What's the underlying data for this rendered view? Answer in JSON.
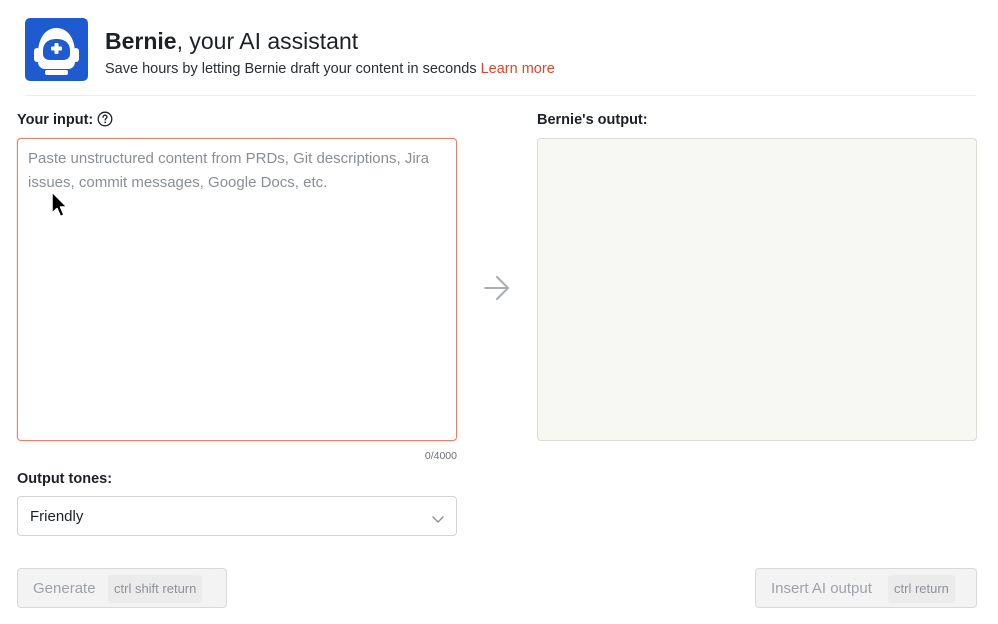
{
  "header": {
    "brand_name": "Bernie",
    "title_rest": ", your AI assistant",
    "subtitle": "Save hours by letting Bernie draft your content in seconds",
    "learn_more": "Learn more",
    "logo_icon": "astronaut-helmet-icon",
    "brand_color": "#1f5bd0",
    "link_color": "#e0452a"
  },
  "input": {
    "label": "Your input:",
    "help_icon": "question-circle-icon",
    "placeholder": "Paste unstructured content from PRDs, Git descriptions, Jira issues, commit messages, Google Docs, etc.",
    "value": "",
    "counter": "0/4000",
    "focus_border_color": "#e9806a"
  },
  "output": {
    "label": "Bernie's output:",
    "value": "",
    "background_color": "#f7f7f3"
  },
  "arrow_icon": "arrow-right-icon",
  "tones": {
    "label": "Output tones:",
    "selected": "Friendly",
    "chevron_icon": "chevron-down-icon"
  },
  "actions": {
    "generate_label": "Generate",
    "generate_shortcut": "ctrl shift return",
    "insert_label": "Insert AI output",
    "insert_shortcut": "ctrl return"
  }
}
